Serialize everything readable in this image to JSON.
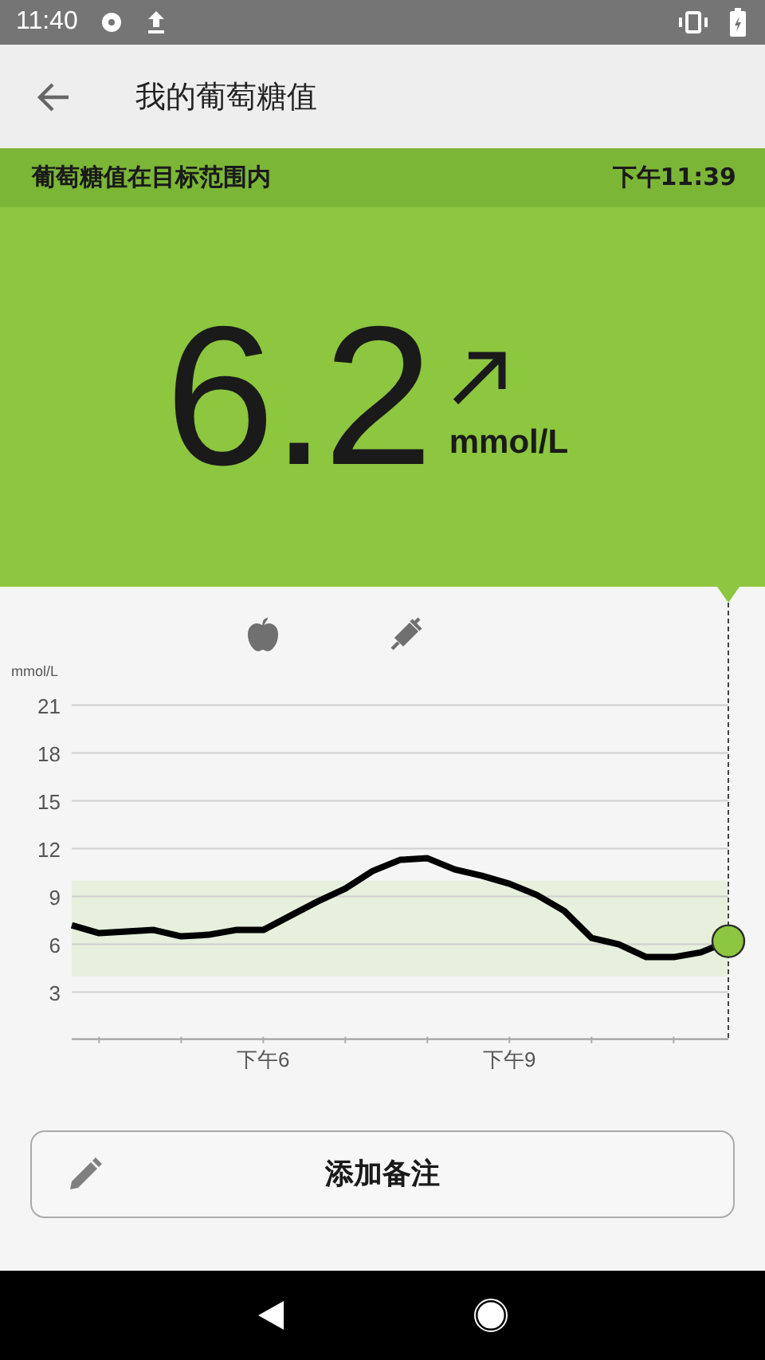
{
  "status_bar": {
    "time": "11:40"
  },
  "app_bar": {
    "title": "我的葡萄糖值"
  },
  "banner": {
    "message": "葡萄糖值在目标范围内",
    "time": "下午11:39"
  },
  "reading": {
    "value": "6.2",
    "unit": "mmol/L"
  },
  "chart": {
    "chart_data": {
      "type": "line",
      "ylabel": "mmol/L",
      "categories": [
        null,
        null,
        null,
        null,
        null,
        null,
        null,
        "下午6",
        null,
        null,
        null,
        null,
        null,
        null,
        null,
        null,
        "下午9",
        null,
        null,
        null,
        null,
        null,
        null,
        null,
        null
      ],
      "series": [
        {
          "color": "#000000",
          "values": [
            7.2,
            6.7,
            6.8,
            6.9,
            6.5,
            6.6,
            6.9,
            6.9,
            7.8,
            8.7,
            9.5,
            10.6,
            11.3,
            11.4,
            10.7,
            10.3,
            9.8,
            9.1,
            8.1,
            6.4,
            6.0,
            5.2,
            5.2,
            5.5,
            6.2
          ]
        }
      ],
      "ylim": [
        0,
        21
      ],
      "grid": true,
      "yticks": [
        3,
        6,
        9,
        12,
        15,
        18,
        21
      ],
      "bands": [
        {
          "axis": "y",
          "from": 4,
          "to": 10
        }
      ]
    },
    "events": [
      {
        "kind": "meal"
      },
      {
        "kind": "insulin"
      }
    ]
  },
  "add_note_button": {
    "label": "添加备注"
  }
}
